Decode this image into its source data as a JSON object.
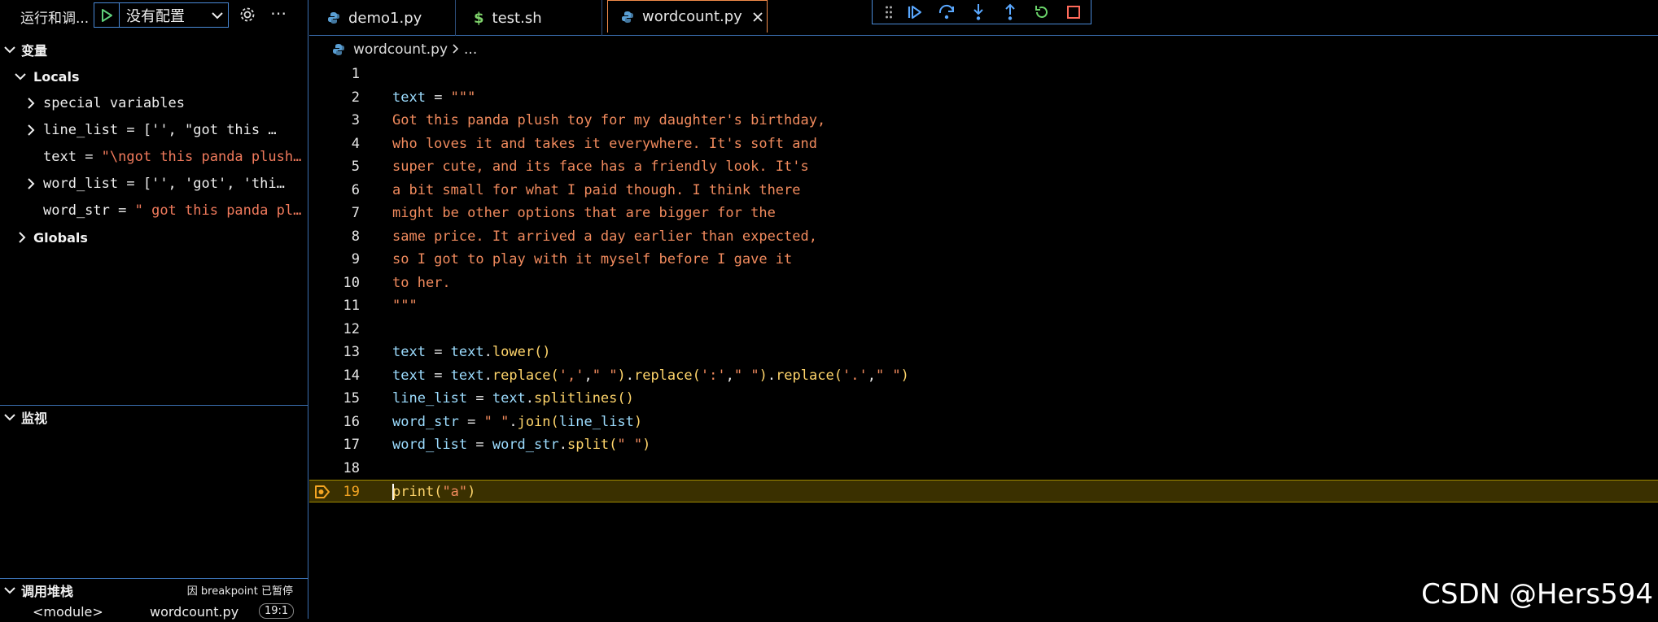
{
  "sidebar": {
    "run_title": "运行和调...",
    "config_label": "没有配置",
    "variables_title": "变量",
    "locals_title": "Locals",
    "locals": [
      {
        "name": "special variables",
        "value": "",
        "kind": "group",
        "expandable": true
      },
      {
        "name": "line_list",
        "value": "['', \"got this panda plush toy for my daughter's birthday,\"",
        "kind": "list",
        "expandable": true
      },
      {
        "name": "text",
        "value": "\"\\ngot this panda plush toy for my daughter's birthday,",
        "kind": "str",
        "expandable": false
      },
      {
        "name": "word_list",
        "value": "['', 'got', 'this', 'panda', 'plush', 'toy']",
        "kind": "list",
        "expandable": true
      },
      {
        "name": "word_str",
        "value": "\" got this panda plush toy for my daughter's",
        "kind": "str",
        "expandable": false
      }
    ],
    "globals_title": "Globals",
    "watch_title": "监视",
    "callstack_title": "调用堆栈",
    "callstack_status": "因 breakpoint 已暂停",
    "callstack_frame": {
      "name": "<module>",
      "file": "wordcount.py",
      "pos": "19:1"
    }
  },
  "tabs": [
    {
      "label": "demo1.py",
      "icon": "python-icon",
      "active": false
    },
    {
      "label": "test.sh",
      "icon": "dollar-icon",
      "active": false
    },
    {
      "label": "wordcount.py",
      "icon": "python-icon",
      "active": true
    }
  ],
  "breadcrumb": {
    "file": "wordcount.py",
    "rest": "..."
  },
  "debug_toolbar": [
    "drag-handle-icon",
    "continue-icon",
    "step-over-icon",
    "step-into-icon",
    "step-out-icon",
    "restart-icon",
    "stop-icon"
  ],
  "editor": {
    "current_line": 19,
    "lines": [
      {
        "n": "1",
        "tokens": []
      },
      {
        "n": "2",
        "tokens": [
          [
            "var",
            "text"
          ],
          [
            "op",
            " = "
          ],
          [
            "str",
            "\"\"\""
          ]
        ]
      },
      {
        "n": "3",
        "tokens": [
          [
            "str",
            "Got this panda plush toy for my daughter's birthday,"
          ]
        ]
      },
      {
        "n": "4",
        "tokens": [
          [
            "str",
            "who loves it and takes it everywhere. It's soft and"
          ]
        ]
      },
      {
        "n": "5",
        "tokens": [
          [
            "str",
            "super cute, and its face has a friendly look. It's"
          ]
        ]
      },
      {
        "n": "6",
        "tokens": [
          [
            "str",
            "a bit small for what I paid though. I think there"
          ]
        ]
      },
      {
        "n": "7",
        "tokens": [
          [
            "str",
            "might be other options that are bigger for the"
          ]
        ]
      },
      {
        "n": "8",
        "tokens": [
          [
            "str",
            "same price. It arrived a day earlier than expected,"
          ]
        ]
      },
      {
        "n": "9",
        "tokens": [
          [
            "str",
            "so I got to play with it myself before I gave it"
          ]
        ]
      },
      {
        "n": "10",
        "tokens": [
          [
            "str",
            "to her."
          ]
        ]
      },
      {
        "n": "11",
        "tokens": [
          [
            "str",
            "\"\"\""
          ]
        ]
      },
      {
        "n": "12",
        "tokens": []
      },
      {
        "n": "13",
        "tokens": [
          [
            "var",
            "text"
          ],
          [
            "op",
            " = "
          ],
          [
            "var",
            "text"
          ],
          [
            "op",
            "."
          ],
          [
            "fn",
            "lower"
          ],
          [
            "fn",
            "()"
          ]
        ]
      },
      {
        "n": "14",
        "tokens": [
          [
            "var",
            "text"
          ],
          [
            "op",
            " = "
          ],
          [
            "var",
            "text"
          ],
          [
            "op",
            "."
          ],
          [
            "fn",
            "replace"
          ],
          [
            "fn",
            "("
          ],
          [
            "str",
            "','"
          ],
          [
            "op",
            ","
          ],
          [
            "str",
            "\" \""
          ],
          [
            "fn",
            ")"
          ],
          [
            "op",
            "."
          ],
          [
            "fn",
            "replace"
          ],
          [
            "fn",
            "("
          ],
          [
            "str",
            "':'"
          ],
          [
            "op",
            ","
          ],
          [
            "str",
            "\" \""
          ],
          [
            "fn",
            ")"
          ],
          [
            "op",
            "."
          ],
          [
            "fn",
            "replace"
          ],
          [
            "fn",
            "("
          ],
          [
            "str",
            "'.'"
          ],
          [
            "op",
            ","
          ],
          [
            "str",
            "\" \""
          ],
          [
            "fn",
            ")"
          ]
        ]
      },
      {
        "n": "15",
        "tokens": [
          [
            "var",
            "line_list"
          ],
          [
            "op",
            " = "
          ],
          [
            "var",
            "text"
          ],
          [
            "op",
            "."
          ],
          [
            "fn",
            "splitlines"
          ],
          [
            "fn",
            "()"
          ]
        ]
      },
      {
        "n": "16",
        "tokens": [
          [
            "var",
            "word_str"
          ],
          [
            "op",
            " = "
          ],
          [
            "str",
            "\" \""
          ],
          [
            "op",
            "."
          ],
          [
            "fn",
            "join"
          ],
          [
            "fn",
            "("
          ],
          [
            "var",
            "line_list"
          ],
          [
            "fn",
            ")"
          ]
        ]
      },
      {
        "n": "17",
        "tokens": [
          [
            "var",
            "word_list"
          ],
          [
            "op",
            " = "
          ],
          [
            "var",
            "word_str"
          ],
          [
            "op",
            "."
          ],
          [
            "fn",
            "split"
          ],
          [
            "fn",
            "("
          ],
          [
            "str",
            "\" \""
          ],
          [
            "fn",
            ")"
          ]
        ]
      },
      {
        "n": "18",
        "tokens": []
      },
      {
        "n": "19",
        "tokens": [
          [
            "fn",
            "print"
          ],
          [
            "fn",
            "("
          ],
          [
            "str",
            "\"a\""
          ],
          [
            "fn",
            ")"
          ]
        ]
      }
    ]
  },
  "watermark": "CSDN @Hers594",
  "colors": {
    "accent": "#4a8ad8",
    "active_tab_border": "#f28b4a",
    "string": "#f08a5d",
    "variable": "#9cdcfe",
    "function": "#ffd56b",
    "current_line_bg": "#3a3000"
  }
}
